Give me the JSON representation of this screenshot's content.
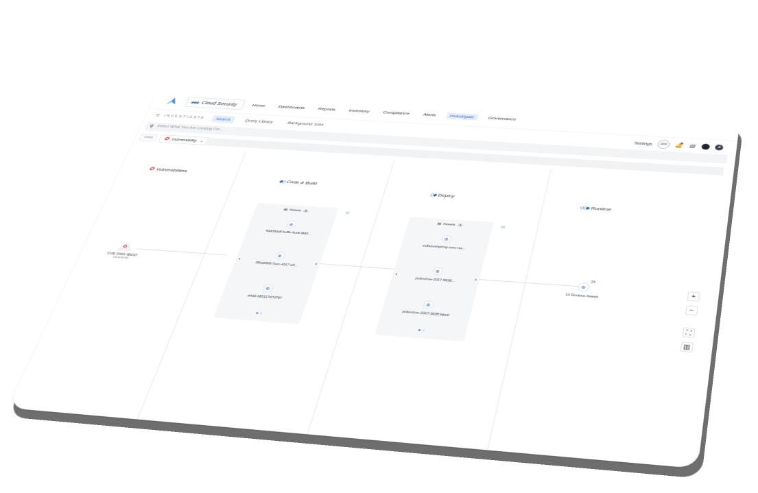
{
  "header": {
    "product": "Cloud Security",
    "nav": [
      {
        "label": "Home",
        "active": false
      },
      {
        "label": "Dashboards",
        "active": false
      },
      {
        "label": "Reports",
        "active": false
      },
      {
        "label": "Inventory",
        "active": false
      },
      {
        "label": "Compliance",
        "active": false
      },
      {
        "label": "Alerts",
        "active": false
      },
      {
        "label": "Investigate",
        "active": true
      },
      {
        "label": "Governance",
        "active": false
      }
    ]
  },
  "subnav": {
    "section": "INVESTIGATE",
    "tabs": [
      {
        "label": "Search",
        "active": true
      },
      {
        "label": "Query Library",
        "active": false
      },
      {
        "label": "Background Jobs",
        "active": false
      }
    ],
    "settings": "Settings",
    "progress": "19%"
  },
  "search": {
    "placeholder": "Select What You Are Looking For..."
  },
  "find": {
    "label": "FIND",
    "entity": "Vulnerability"
  },
  "stages": {
    "vulnerabilities": "Vulnerabilities",
    "code_build": "Code & Build",
    "deploy": "Deploy",
    "runtime": "Runtime"
  },
  "code_build_panel": {
    "title": "Assets",
    "count": "6",
    "assets": [
      "43dd5dc8-be8b-4ce8-9bbf...",
      "f90d1695-7cec-4217-a4...",
      "a4d0-085117d7d737"
    ]
  },
  "deploy_panel": {
    "title": "Assets",
    "count": "4",
    "assets": [
      "vulfocus/spring-core-rce...",
      "jrrdev/cve-2017-5638...",
      "jrrdev/cve-2017-5638:latest"
    ]
  },
  "cve": {
    "id": "CVE-2021-38297",
    "type": "Vulnerability"
  },
  "runtime_node": {
    "count": "14",
    "label": "14 Runtime Assets"
  },
  "colors": {
    "accent": "#2f6fcc",
    "alert": "#e0342c",
    "panel": "#f5f6f8"
  }
}
